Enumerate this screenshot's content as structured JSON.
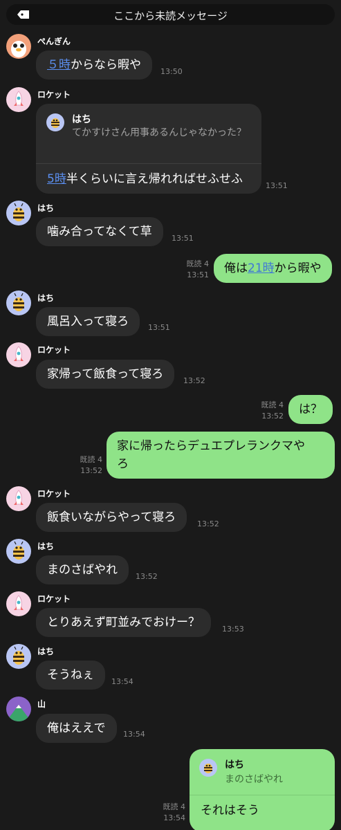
{
  "banner": {
    "title": "ここから未読メッセージ",
    "icon": "tag-icon"
  },
  "messages": {
    "m1": {
      "sender": "ぺんぎん",
      "link": "５時",
      "text": "からなら暇や",
      "time": "13:50"
    },
    "m2": {
      "sender": "ロケット",
      "quote_sender": "はち",
      "quote_text": "てかすけさん用事あるんじゃなかった？",
      "link": "5時",
      "text": "半くらいに言え帰れればせふせふ",
      "time": "13:51"
    },
    "m3": {
      "sender": "はち",
      "text": "噛み合ってなくて草",
      "time": "13:51"
    },
    "m4": {
      "prefix": "俺は",
      "link": "21時",
      "text": "から暇や",
      "read": "既読 4",
      "time": "13:51"
    },
    "m5": {
      "sender": "はち",
      "text": "風呂入って寝ろ",
      "time": "13:51"
    },
    "m6": {
      "sender": "ロケット",
      "text": "家帰って飯食って寝ろ",
      "time": "13:52"
    },
    "m7": {
      "text": "は？",
      "read": "既読 4",
      "time": "13:52"
    },
    "m8": {
      "line1": "家に帰ったらデュエプレランクマや",
      "line2": "ろ",
      "read": "既読 4",
      "time": "13:52"
    },
    "m9": {
      "sender": "ロケット",
      "text": "飯食いながらやって寝ろ",
      "time": "13:52"
    },
    "m10": {
      "sender": "はち",
      "text": "まのさばやれ",
      "time": "13:52"
    },
    "m11": {
      "sender": "ロケット",
      "text": "とりあえず町並みでおけー？",
      "time": "13:53"
    },
    "m12": {
      "sender": "はち",
      "text": "そうねぇ",
      "time": "13:54"
    },
    "m13": {
      "sender": "山",
      "text": "俺はええで",
      "time": "13:54"
    },
    "m14": {
      "quote_sender": "はち",
      "quote_text": "まのさばやれ",
      "text": "それはそう",
      "read": "既読 4",
      "time": "13:54"
    }
  },
  "colors": {
    "background": "#1a1a1a",
    "incoming_bubble": "#2c2c2c",
    "outgoing_bubble": "#8fe388",
    "link": "#5b8ff0"
  }
}
